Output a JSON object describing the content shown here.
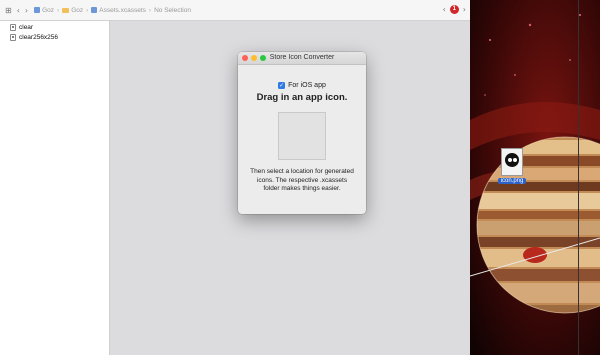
{
  "toolbar": {
    "grid_icon": "grid-icon",
    "back_icon": "chevron-left-icon",
    "forward_icon": "chevron-right-icon",
    "breadcrumbs": [
      "Goz",
      "Goz",
      "Assets.xcassets",
      "No Selection"
    ],
    "alert_count": "1"
  },
  "sidebar": {
    "items": [
      {
        "label": "clear"
      },
      {
        "label": "clear256x256"
      }
    ]
  },
  "window": {
    "title": "Store Icon Converter",
    "checkbox_label": "For iOS app",
    "checkbox_checked": true,
    "heading": "Drag in an app icon.",
    "description": "Then select a location for generated icons. The respective .xcassets folder makes things easier."
  },
  "desktop": {
    "file_label": "icon.png"
  },
  "colors": {
    "close": "#fe5f57",
    "minimize": "#febc2e",
    "zoom": "#28c840",
    "accent": "#2f7ae5"
  }
}
